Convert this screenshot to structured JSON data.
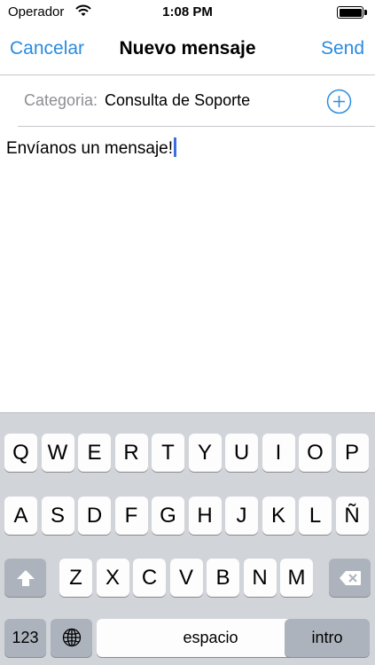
{
  "status_bar": {
    "carrier": "Operador",
    "time": "1:08 PM"
  },
  "nav": {
    "cancel_label": "Cancelar",
    "title": "Nuevo mensaje",
    "send_label": "Send"
  },
  "category": {
    "label": "Categoria:",
    "value": "Consulta de Soporte"
  },
  "message": {
    "text": "Envíanos un mensaje!"
  },
  "keyboard": {
    "row1": [
      "Q",
      "W",
      "E",
      "R",
      "T",
      "Y",
      "U",
      "I",
      "O",
      "P"
    ],
    "row2": [
      "A",
      "S",
      "D",
      "F",
      "G",
      "H",
      "J",
      "K",
      "L",
      "Ñ"
    ],
    "row3": [
      "Z",
      "X",
      "C",
      "V",
      "B",
      "N",
      "M"
    ],
    "numbers_label": "123",
    "space_label": "espacio",
    "return_label": "intro"
  },
  "colors": {
    "accent": "#2a8be0",
    "caret": "#3b6fe0",
    "keyboard_bg": "#d1d4d9",
    "function_key": "#adb3bc"
  },
  "icons": [
    "wifi-icon",
    "battery-icon",
    "add-circle-icon",
    "shift-icon",
    "backspace-icon",
    "globe-icon"
  ]
}
